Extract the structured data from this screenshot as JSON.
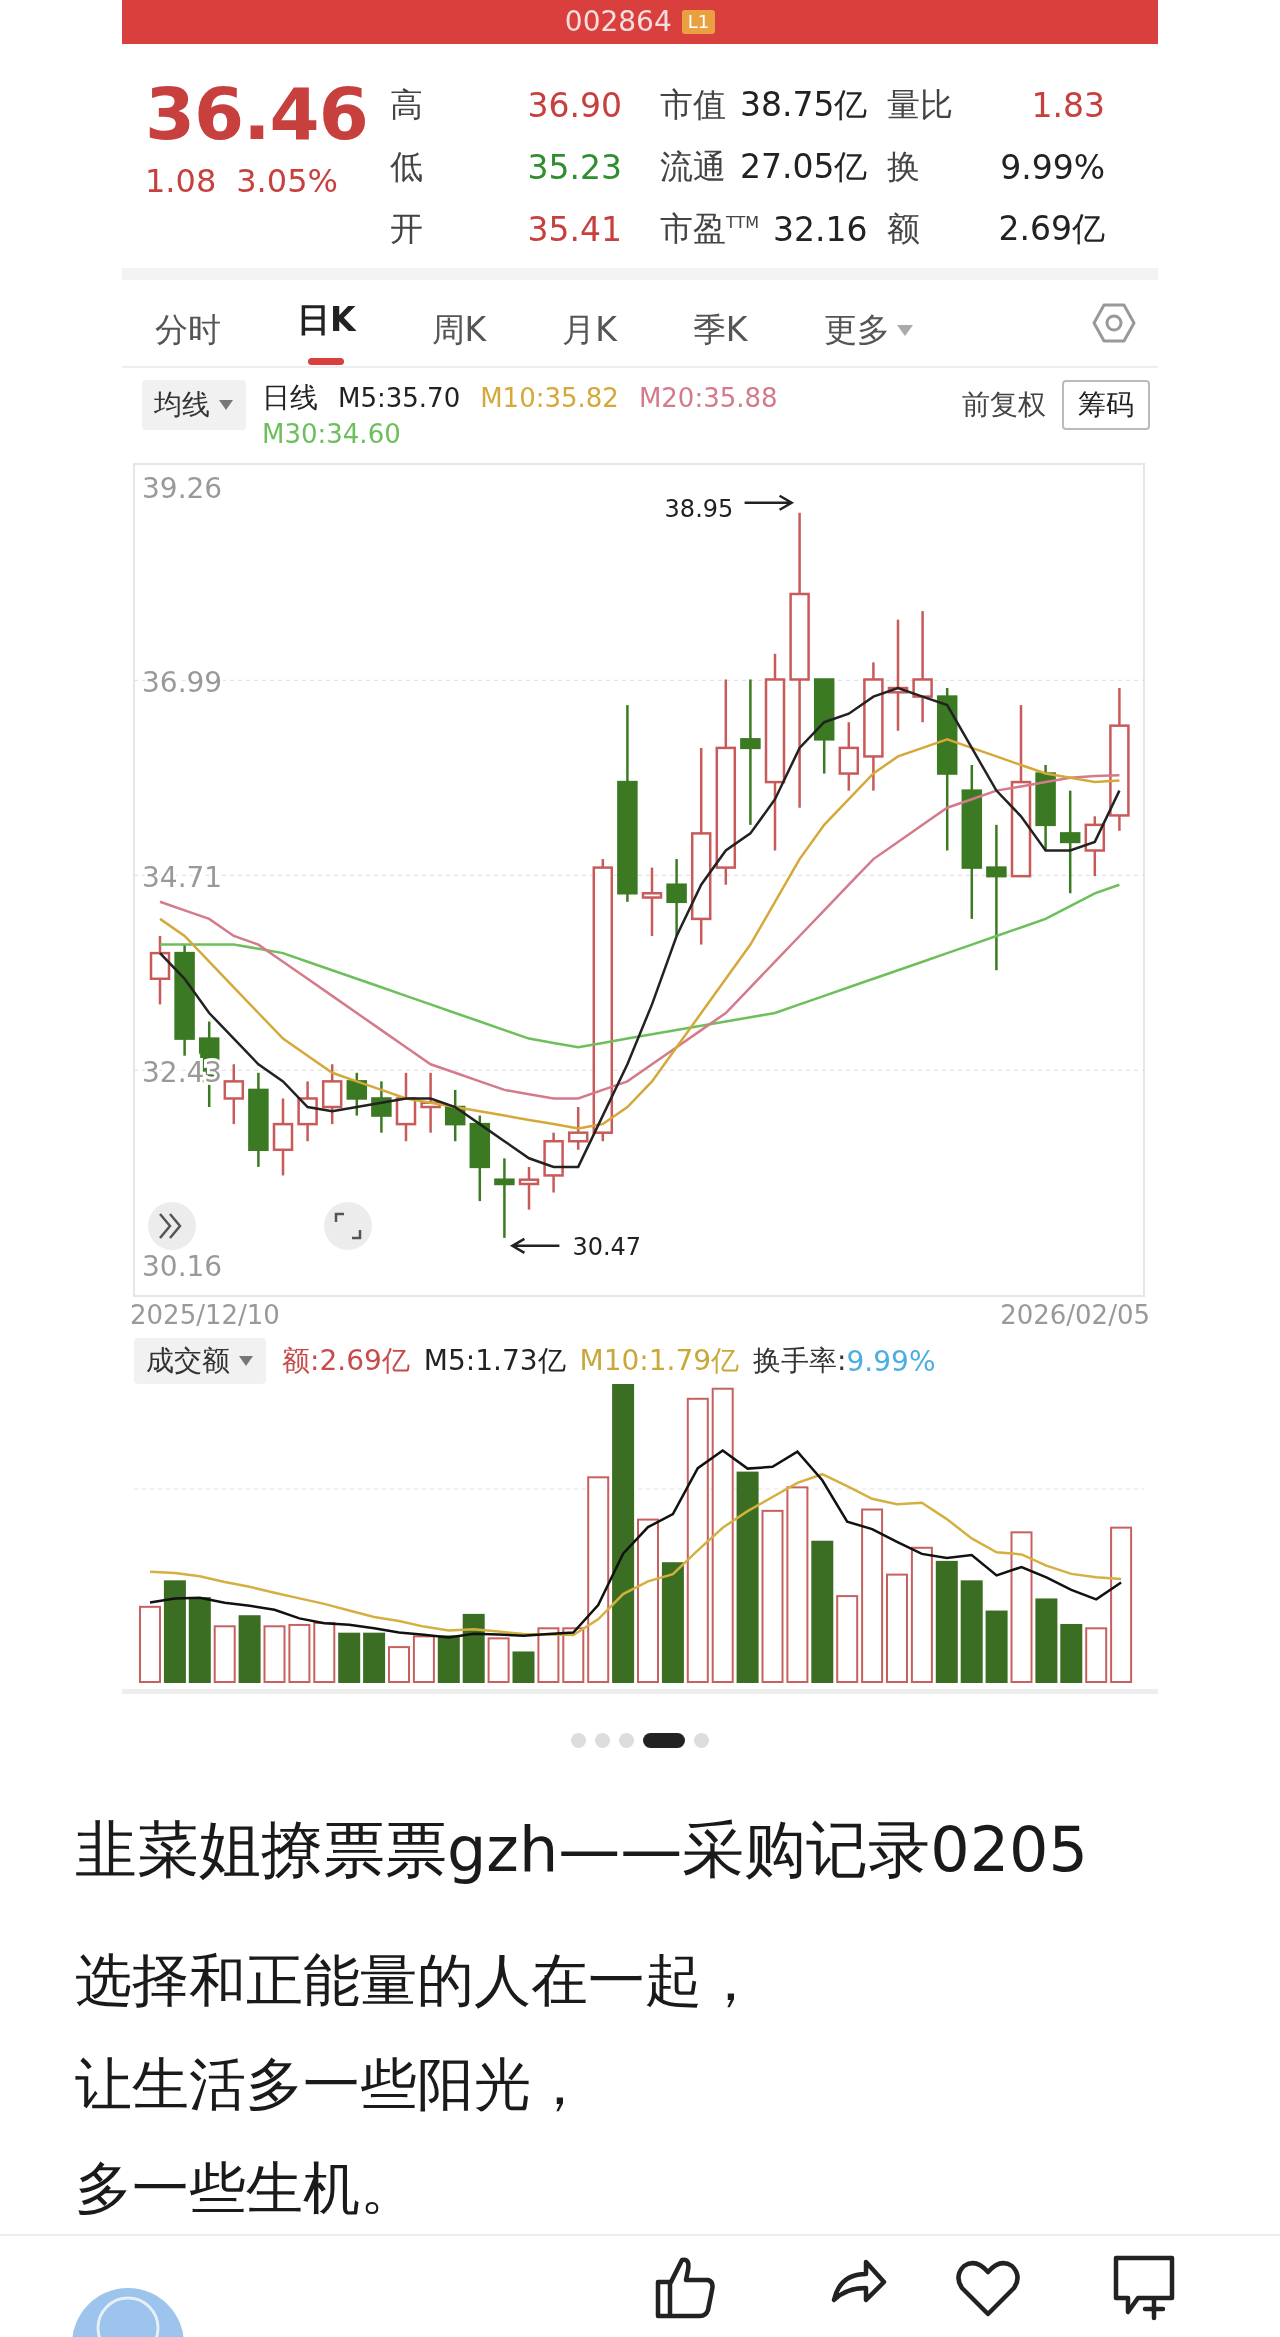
{
  "header": {
    "code": "002864",
    "badge": "L1"
  },
  "quote": {
    "price": "36.46",
    "change": "1.08",
    "change_pct": "3.05%",
    "color": "#c8403e",
    "stats": [
      {
        "label": "高",
        "value": "36.90",
        "color": "#c8403e"
      },
      {
        "label": "市值",
        "value": "38.75亿",
        "color": "#222222"
      },
      {
        "label": "量比",
        "value": "1.83",
        "color": "#c8403e"
      },
      {
        "label": "低",
        "value": "35.23",
        "color": "#2f8f2f"
      },
      {
        "label": "流通",
        "value": "27.05亿",
        "color": "#222222"
      },
      {
        "label": "换",
        "value": "9.99%",
        "color": "#222222"
      },
      {
        "label": "开",
        "value": "35.41",
        "color": "#c8403e"
      },
      {
        "label": "市盈$^{TTM}$",
        "value": "32.16",
        "color": "#222222"
      },
      {
        "label": "额",
        "value": "2.69亿",
        "color": "#222222"
      }
    ]
  },
  "tabs": [
    {
      "label": "分时",
      "selected": false,
      "kind": "tab"
    },
    {
      "label": "日K",
      "selected": true,
      "kind": "tab"
    },
    {
      "label": "周K",
      "selected": false,
      "kind": "tab"
    },
    {
      "label": "月K",
      "selected": false,
      "kind": "tab"
    },
    {
      "label": "季K",
      "selected": false,
      "kind": "tab"
    },
    {
      "label": "更多",
      "selected": false,
      "kind": "menu"
    }
  ],
  "legend": {
    "selector": "均线",
    "period": "日线",
    "readings": [
      ":35.70",
      ":35.82",
      ":35.88",
      ":34.60"
    ],
    "adjust": "前复权",
    "chips_button": "筹码"
  },
  "kline": {
    "high_note": "38.95",
    "low_note": "30.47",
    "start_date": "2025/12/10",
    "end_date": "2026/02/05",
    "chart_data": {
      "type": "line",
      "grid": true,
      "ylim": [
        29.79,
        39.52
      ],
      "yticks": [
        {
          "value": 39.26,
          "label": "39.26"
        },
        {
          "value": 36.99,
          "label": "36.99"
        },
        {
          "value": 34.71,
          "label": "34.71"
        },
        {
          "value": 32.43,
          "label": "32.43"
        },
        {
          "value": 30.16,
          "label": "30.16"
        }
      ],
      "series": [
        {
          "name": "M5",
          "color": "#222222",
          "values": [
            33.8,
            33.5,
            33.1,
            32.8,
            32.5,
            32.3,
            32.0,
            31.95,
            32.0,
            32.05,
            32.1,
            32.1,
            32.0,
            31.8,
            31.6,
            31.4,
            31.3,
            31.3,
            31.9,
            32.5,
            33.2,
            34.0,
            34.6,
            35.0,
            35.2,
            35.6,
            36.2,
            36.5,
            36.6,
            36.8,
            36.9,
            36.8,
            36.7,
            36.2,
            35.7,
            35.4,
            35.0,
            35.0,
            35.1,
            35.7
          ]
        },
        {
          "name": "M10",
          "color": "#d4a93a",
          "values": [
            34.2,
            34.0,
            33.7,
            33.4,
            33.1,
            32.8,
            32.6,
            32.4,
            32.3,
            32.2,
            32.1,
            32.05,
            32.0,
            31.95,
            31.9,
            31.85,
            31.8,
            31.75,
            31.8,
            32.0,
            32.3,
            32.7,
            33.1,
            33.5,
            33.9,
            34.4,
            34.9,
            35.3,
            35.6,
            35.9,
            36.1,
            36.2,
            36.3,
            36.2,
            36.1,
            36.0,
            35.9,
            35.85,
            35.8,
            35.82
          ]
        },
        {
          "name": "M20",
          "color": "#d47a8a",
          "values": [
            34.4,
            34.3,
            34.2,
            34.0,
            33.9,
            33.7,
            33.5,
            33.3,
            33.1,
            32.9,
            32.7,
            32.5,
            32.4,
            32.3,
            32.2,
            32.15,
            32.1,
            32.1,
            32.2,
            32.3,
            32.5,
            32.7,
            32.9,
            33.1,
            33.4,
            33.7,
            34.0,
            34.3,
            34.6,
            34.9,
            35.1,
            35.3,
            35.5,
            35.6,
            35.7,
            35.75,
            35.8,
            35.85,
            35.87,
            35.88
          ]
        },
        {
          "name": "M30",
          "color": "#6cbf5a",
          "values": [
            33.9,
            33.9,
            33.9,
            33.9,
            33.85,
            33.8,
            33.7,
            33.6,
            33.5,
            33.4,
            33.3,
            33.2,
            33.1,
            33.0,
            32.9,
            32.8,
            32.75,
            32.7,
            32.75,
            32.8,
            32.85,
            32.9,
            32.95,
            33.0,
            33.05,
            33.1,
            33.2,
            33.3,
            33.4,
            33.5,
            33.6,
            33.7,
            33.8,
            33.9,
            34.0,
            34.1,
            34.2,
            34.35,
            34.5,
            34.6
          ]
        }
      ]
    }
  },
  "volume": {
    "selector": "成交额",
    "stats": [
      {
        "text": "额:2.69亿",
        "color": "#c84a4a"
      },
      {
        "text": "M5:1.73亿",
        "color": "#222222"
      },
      {
        "text": "M10:1.79亿",
        "color": "#c9a83a"
      },
      {
        "text": "换手率:",
        "color": "#333333"
      },
      {
        "text": "9.99%",
        "color": "#4aaee0"
      }
    ]
  },
  "pager": [
    {
      "selected": false
    },
    {
      "selected": false
    },
    {
      "selected": false
    },
    {
      "selected": true
    },
    {
      "selected": false
    }
  ],
  "post": {
    "title": "韭菜姐撩票票gzh——采购记录0205",
    "lines": [
      "选择和正能量的人在一起，",
      "让生活多一些阳光，",
      "多一些生机。"
    ]
  }
}
